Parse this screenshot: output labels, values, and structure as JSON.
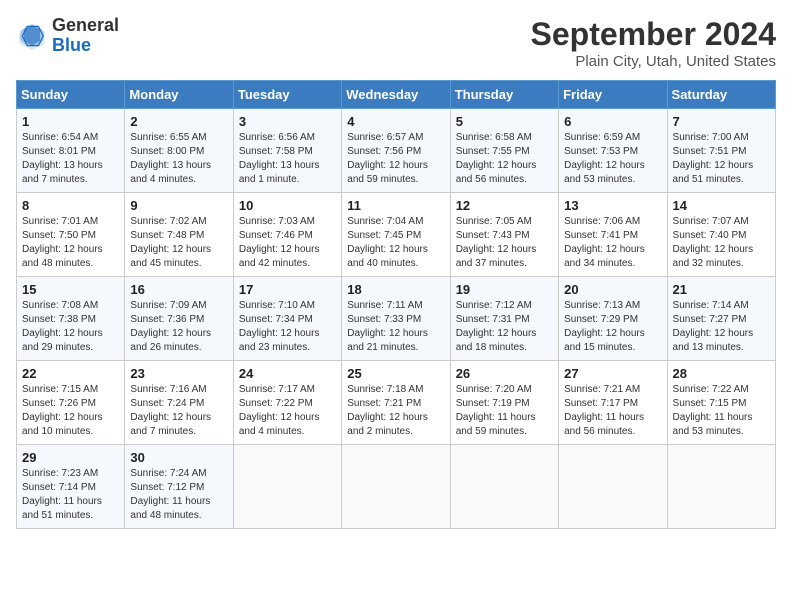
{
  "header": {
    "logo_general": "General",
    "logo_blue": "Blue",
    "month_title": "September 2024",
    "location": "Plain City, Utah, United States"
  },
  "days_of_week": [
    "Sunday",
    "Monday",
    "Tuesday",
    "Wednesday",
    "Thursday",
    "Friday",
    "Saturday"
  ],
  "weeks": [
    [
      {
        "day": "1",
        "sunrise": "6:54 AM",
        "sunset": "8:01 PM",
        "daylight": "13 hours and 7 minutes."
      },
      {
        "day": "2",
        "sunrise": "6:55 AM",
        "sunset": "8:00 PM",
        "daylight": "13 hours and 4 minutes."
      },
      {
        "day": "3",
        "sunrise": "6:56 AM",
        "sunset": "7:58 PM",
        "daylight": "13 hours and 1 minute."
      },
      {
        "day": "4",
        "sunrise": "6:57 AM",
        "sunset": "7:56 PM",
        "daylight": "12 hours and 59 minutes."
      },
      {
        "day": "5",
        "sunrise": "6:58 AM",
        "sunset": "7:55 PM",
        "daylight": "12 hours and 56 minutes."
      },
      {
        "day": "6",
        "sunrise": "6:59 AM",
        "sunset": "7:53 PM",
        "daylight": "12 hours and 53 minutes."
      },
      {
        "day": "7",
        "sunrise": "7:00 AM",
        "sunset": "7:51 PM",
        "daylight": "12 hours and 51 minutes."
      }
    ],
    [
      {
        "day": "8",
        "sunrise": "7:01 AM",
        "sunset": "7:50 PM",
        "daylight": "12 hours and 48 minutes."
      },
      {
        "day": "9",
        "sunrise": "7:02 AM",
        "sunset": "7:48 PM",
        "daylight": "12 hours and 45 minutes."
      },
      {
        "day": "10",
        "sunrise": "7:03 AM",
        "sunset": "7:46 PM",
        "daylight": "12 hours and 42 minutes."
      },
      {
        "day": "11",
        "sunrise": "7:04 AM",
        "sunset": "7:45 PM",
        "daylight": "12 hours and 40 minutes."
      },
      {
        "day": "12",
        "sunrise": "7:05 AM",
        "sunset": "7:43 PM",
        "daylight": "12 hours and 37 minutes."
      },
      {
        "day": "13",
        "sunrise": "7:06 AM",
        "sunset": "7:41 PM",
        "daylight": "12 hours and 34 minutes."
      },
      {
        "day": "14",
        "sunrise": "7:07 AM",
        "sunset": "7:40 PM",
        "daylight": "12 hours and 32 minutes."
      }
    ],
    [
      {
        "day": "15",
        "sunrise": "7:08 AM",
        "sunset": "7:38 PM",
        "daylight": "12 hours and 29 minutes."
      },
      {
        "day": "16",
        "sunrise": "7:09 AM",
        "sunset": "7:36 PM",
        "daylight": "12 hours and 26 minutes."
      },
      {
        "day": "17",
        "sunrise": "7:10 AM",
        "sunset": "7:34 PM",
        "daylight": "12 hours and 23 minutes."
      },
      {
        "day": "18",
        "sunrise": "7:11 AM",
        "sunset": "7:33 PM",
        "daylight": "12 hours and 21 minutes."
      },
      {
        "day": "19",
        "sunrise": "7:12 AM",
        "sunset": "7:31 PM",
        "daylight": "12 hours and 18 minutes."
      },
      {
        "day": "20",
        "sunrise": "7:13 AM",
        "sunset": "7:29 PM",
        "daylight": "12 hours and 15 minutes."
      },
      {
        "day": "21",
        "sunrise": "7:14 AM",
        "sunset": "7:27 PM",
        "daylight": "12 hours and 13 minutes."
      }
    ],
    [
      {
        "day": "22",
        "sunrise": "7:15 AM",
        "sunset": "7:26 PM",
        "daylight": "12 hours and 10 minutes."
      },
      {
        "day": "23",
        "sunrise": "7:16 AM",
        "sunset": "7:24 PM",
        "daylight": "12 hours and 7 minutes."
      },
      {
        "day": "24",
        "sunrise": "7:17 AM",
        "sunset": "7:22 PM",
        "daylight": "12 hours and 4 minutes."
      },
      {
        "day": "25",
        "sunrise": "7:18 AM",
        "sunset": "7:21 PM",
        "daylight": "12 hours and 2 minutes."
      },
      {
        "day": "26",
        "sunrise": "7:20 AM",
        "sunset": "7:19 PM",
        "daylight": "11 hours and 59 minutes."
      },
      {
        "day": "27",
        "sunrise": "7:21 AM",
        "sunset": "7:17 PM",
        "daylight": "11 hours and 56 minutes."
      },
      {
        "day": "28",
        "sunrise": "7:22 AM",
        "sunset": "7:15 PM",
        "daylight": "11 hours and 53 minutes."
      }
    ],
    [
      {
        "day": "29",
        "sunrise": "7:23 AM",
        "sunset": "7:14 PM",
        "daylight": "11 hours and 51 minutes."
      },
      {
        "day": "30",
        "sunrise": "7:24 AM",
        "sunset": "7:12 PM",
        "daylight": "11 hours and 48 minutes."
      },
      null,
      null,
      null,
      null,
      null
    ]
  ]
}
